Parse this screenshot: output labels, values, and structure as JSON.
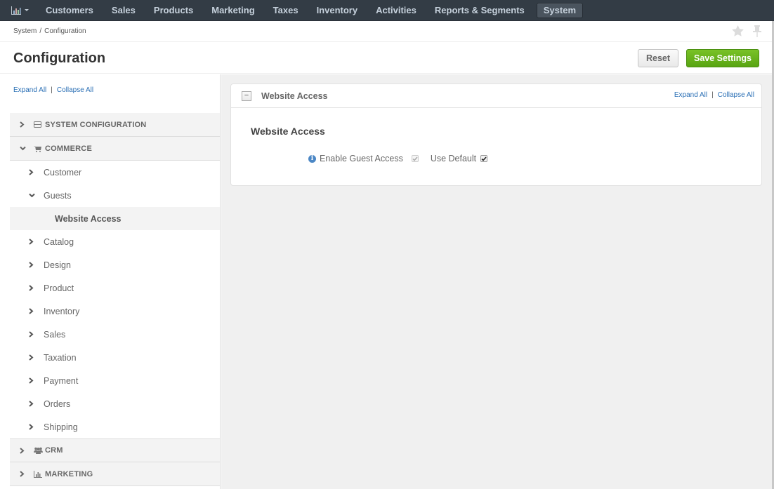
{
  "nav": {
    "dashboard_icon": "bar-chart-icon",
    "items": [
      {
        "label": "Customers"
      },
      {
        "label": "Sales"
      },
      {
        "label": "Products"
      },
      {
        "label": "Marketing"
      },
      {
        "label": "Taxes"
      },
      {
        "label": "Inventory"
      },
      {
        "label": "Activities"
      },
      {
        "label": "Reports & Segments"
      },
      {
        "label": "System",
        "active": true
      }
    ]
  },
  "breadcrumb": {
    "parts": [
      "System",
      "Configuration"
    ],
    "separator": "/"
  },
  "header": {
    "title": "Configuration",
    "reset_label": "Reset",
    "save_label": "Save Settings"
  },
  "sidebar": {
    "expand_all": "Expand All",
    "collapse_all": "Collapse All",
    "divider": "|",
    "sections": [
      {
        "label": "SYSTEM CONFIGURATION",
        "icon": "server-icon",
        "expanded": false
      },
      {
        "label": "COMMERCE",
        "icon": "cart-icon",
        "expanded": true,
        "children": [
          {
            "label": "Customer",
            "expanded": false
          },
          {
            "label": "Guests",
            "expanded": true,
            "children": [
              {
                "label": "Website Access",
                "selected": true
              }
            ]
          },
          {
            "label": "Catalog",
            "expanded": false
          },
          {
            "label": "Design",
            "expanded": false
          },
          {
            "label": "Product",
            "expanded": false
          },
          {
            "label": "Inventory",
            "expanded": false
          },
          {
            "label": "Sales",
            "expanded": false
          },
          {
            "label": "Taxation",
            "expanded": false
          },
          {
            "label": "Payment",
            "expanded": false
          },
          {
            "label": "Orders",
            "expanded": false
          },
          {
            "label": "Shipping",
            "expanded": false
          }
        ]
      },
      {
        "label": "CRM",
        "icon": "users-icon",
        "expanded": false
      },
      {
        "label": "MARKETING",
        "icon": "bar-chart-icon",
        "expanded": false
      }
    ]
  },
  "panel": {
    "collapse_symbol": "−",
    "title": "Website Access",
    "expand_all": "Expand All",
    "collapse_all": "Collapse All",
    "divider": "|",
    "section_title": "Website Access",
    "fields": [
      {
        "label": "Enable Guest Access",
        "value": true,
        "disabled": true,
        "use_default_label": "Use Default",
        "use_default": true,
        "info_icon": "i"
      }
    ]
  },
  "colors": {
    "nav_bg": "#333c45",
    "link": "#2a6fb5",
    "save_green": "#68b41c",
    "info_blue": "#4b87c5"
  }
}
